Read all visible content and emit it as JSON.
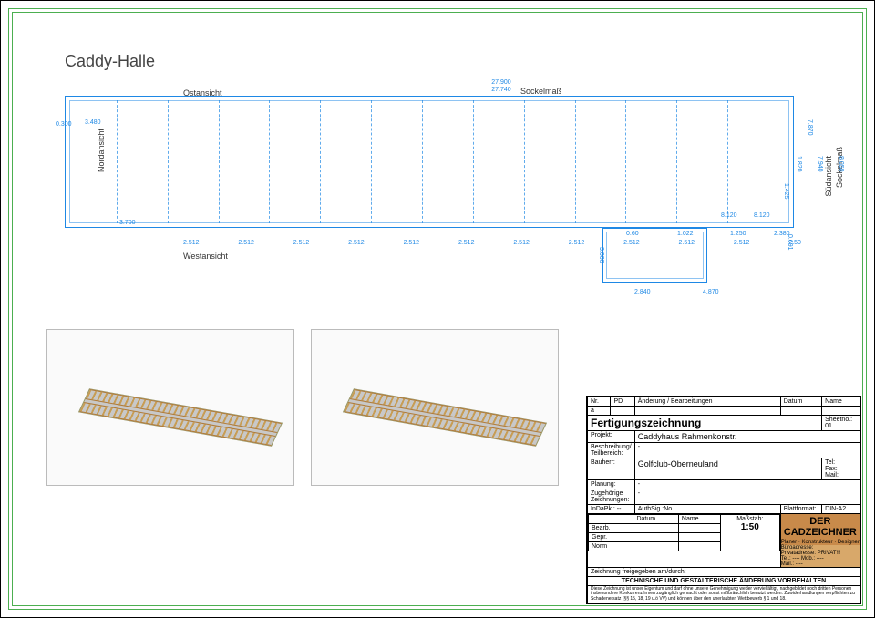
{
  "title": "Caddy-Halle",
  "views": {
    "east": "Ostansicht",
    "west": "Westansicht",
    "north": "Nordansicht",
    "south": "Südansicht",
    "sockel": "Sockelmaß"
  },
  "dims_top": {
    "overall": "27.900",
    "inner": "27.740"
  },
  "dims_left": {
    "a": "0.300",
    "b": "3.480",
    "c": "3.700"
  },
  "dims_right_h": {
    "v1": "8.120",
    "v2": "8.120",
    "v3": "0.60",
    "v4": "1.022",
    "v5": "1.250",
    "v6": "2.380"
  },
  "dims_right_v": {
    "v1": "1.425",
    "v2": "1.820",
    "v3": "7.870",
    "v4": "7.940",
    "v5": "8.050"
  },
  "dims_bottom_bay": "2.512",
  "dims_bottom_n": 11,
  "dims_bottom_last": "2.50",
  "dims_wing": {
    "left": "2.840",
    "right": "4.870",
    "h": "3.000",
    "top_gap": "0.691"
  },
  "titleblock": {
    "rev_header": [
      "Nr.",
      "PD",
      "Änderung / Bearbeitungen",
      "Datum",
      "Name"
    ],
    "rev_row": [
      "a",
      "",
      "",
      "",
      ""
    ],
    "type": "Fertigungszeichnung",
    "sheet_label": "Sheetno.: 01",
    "project_lbl": "Projekt:",
    "project": "Caddyhaus Rahmenkonstr.",
    "desc_lbl": "Beschreibung/\nTeilbereich:",
    "desc": "-",
    "client_lbl": "Bauherr:",
    "client": "Golfclub-Oberneuland",
    "client_contact_lbls": [
      "Tel:",
      "Fax:",
      "Mail:"
    ],
    "planner_lbl": "Planung:",
    "planner": "-",
    "related_lbl": "Zugehörige\nZeichnungen:",
    "related": "-",
    "date_lbl": "InDaPk.: --",
    "authsig_lbl": "AuthSig.:No",
    "format_lbl": "Blattformat:",
    "format": "DIN-A2",
    "meta_row_lbls": [
      "Bearb.",
      "Gepr.",
      "Norm"
    ],
    "meta_date_lbl": "Datum",
    "meta_name_lbl": "Name",
    "scale_lbl": "Maßstab:",
    "scale": "1:50",
    "company": "DER CADZEICHNER",
    "company_sub": "Planer · Konstrukteur · Designer",
    "company_rows": [
      "Büroadresse:",
      "",
      "Privatadresse: PRIVAT!!!",
      "",
      "Tel.: ----  Mob.: ----",
      "Mail.: ----"
    ],
    "release_lbl": "Zeichnung freigegeben am/durch:",
    "reserve": "TECHNISCHE UND GESTALTERISCHE ÄNDERUNG VORBEHALTEN",
    "disclaimer": "Diese Zeichnung ist unser Eigentum und darf ohne unsere Genehmigung weder vervielfältigt, nachgebildet noch dritten Personen insbesondere Konkurrenzfirmen zugänglich gemacht oder sonst mißbräuchlich benutzt werden. Zuwiderhandlungen verpflichten zu Schadenersatz (§§ 15, 18, 19 u.ö VV) und können über den unerlaubten Wettbewerb § 1 und 18."
  }
}
